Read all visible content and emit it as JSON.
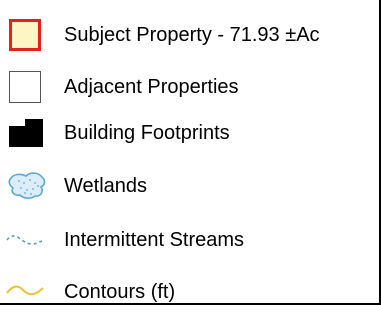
{
  "legend": {
    "items": [
      {
        "symbol": "subject-property-swatch",
        "label": "Subject Property - 71.93 ±Ac",
        "fill": "#fdf5c4",
        "outline": "#e3221b"
      },
      {
        "symbol": "adjacent-property-swatch",
        "label": "Adjacent Properties",
        "fill": "#ffffff",
        "outline": "#555555"
      },
      {
        "symbol": "building-footprint-swatch",
        "label": "Building Footprints",
        "fill": "#000000"
      },
      {
        "symbol": "wetland-swatch",
        "label": "Wetlands",
        "fill": "#dcecf9",
        "outline": "#5aa9d6"
      },
      {
        "symbol": "intermittent-stream-swatch",
        "label": "Intermittent Streams",
        "stroke": "#4a9fd0"
      },
      {
        "symbol": "contour-swatch",
        "label": "Contours (ft)",
        "stroke": "#f2c12e"
      }
    ]
  }
}
